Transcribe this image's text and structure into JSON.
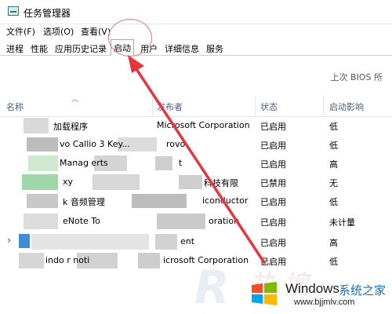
{
  "window": {
    "title": "任务管理器"
  },
  "menu": [
    "文件(F)",
    "选项(O)",
    "查看(V)"
  ],
  "tabs": [
    "进程",
    "性能",
    "应用历史记录",
    "启动",
    "用户",
    "详细信息",
    "服务"
  ],
  "active_tab": "启动",
  "bios_label": "上次 BIOS 所",
  "columns": {
    "name": "名称",
    "publisher": "发布者",
    "status": "状态",
    "impact": "启动影响"
  },
  "rows": [
    {
      "name": "加载程序",
      "publisher": "Microsoft Corporation",
      "status": "已启用",
      "impact": "低"
    },
    {
      "name": "vo Callio    3 Key...",
      "publisher": "rovo",
      "status": "已启用",
      "impact": "低"
    },
    {
      "name": "Manag           erts",
      "publisher": "t",
      "status": "已启用",
      "impact": "高"
    },
    {
      "name": "xy",
      "publisher": "科技有限",
      "status": "已禁用",
      "impact": "无"
    },
    {
      "name": "k    音频管理",
      "publisher": "iconductor",
      "status": "已启用",
      "impact": "低"
    },
    {
      "name": "eNote To",
      "publisher": "oration",
      "status": "已启用",
      "impact": "未计量"
    },
    {
      "name": "",
      "publisher": "ent",
      "status": "已启用",
      "impact": "高"
    },
    {
      "name": "indo         r noti",
      "publisher": "icrosoft Corporation",
      "status": "已启用",
      "impact": "低"
    }
  ],
  "watermark": {
    "logo_text": "Windows",
    "logo_cn": "系统之家",
    "url": "www.bjjmlv.com"
  },
  "annotation_color": "#e8343a"
}
